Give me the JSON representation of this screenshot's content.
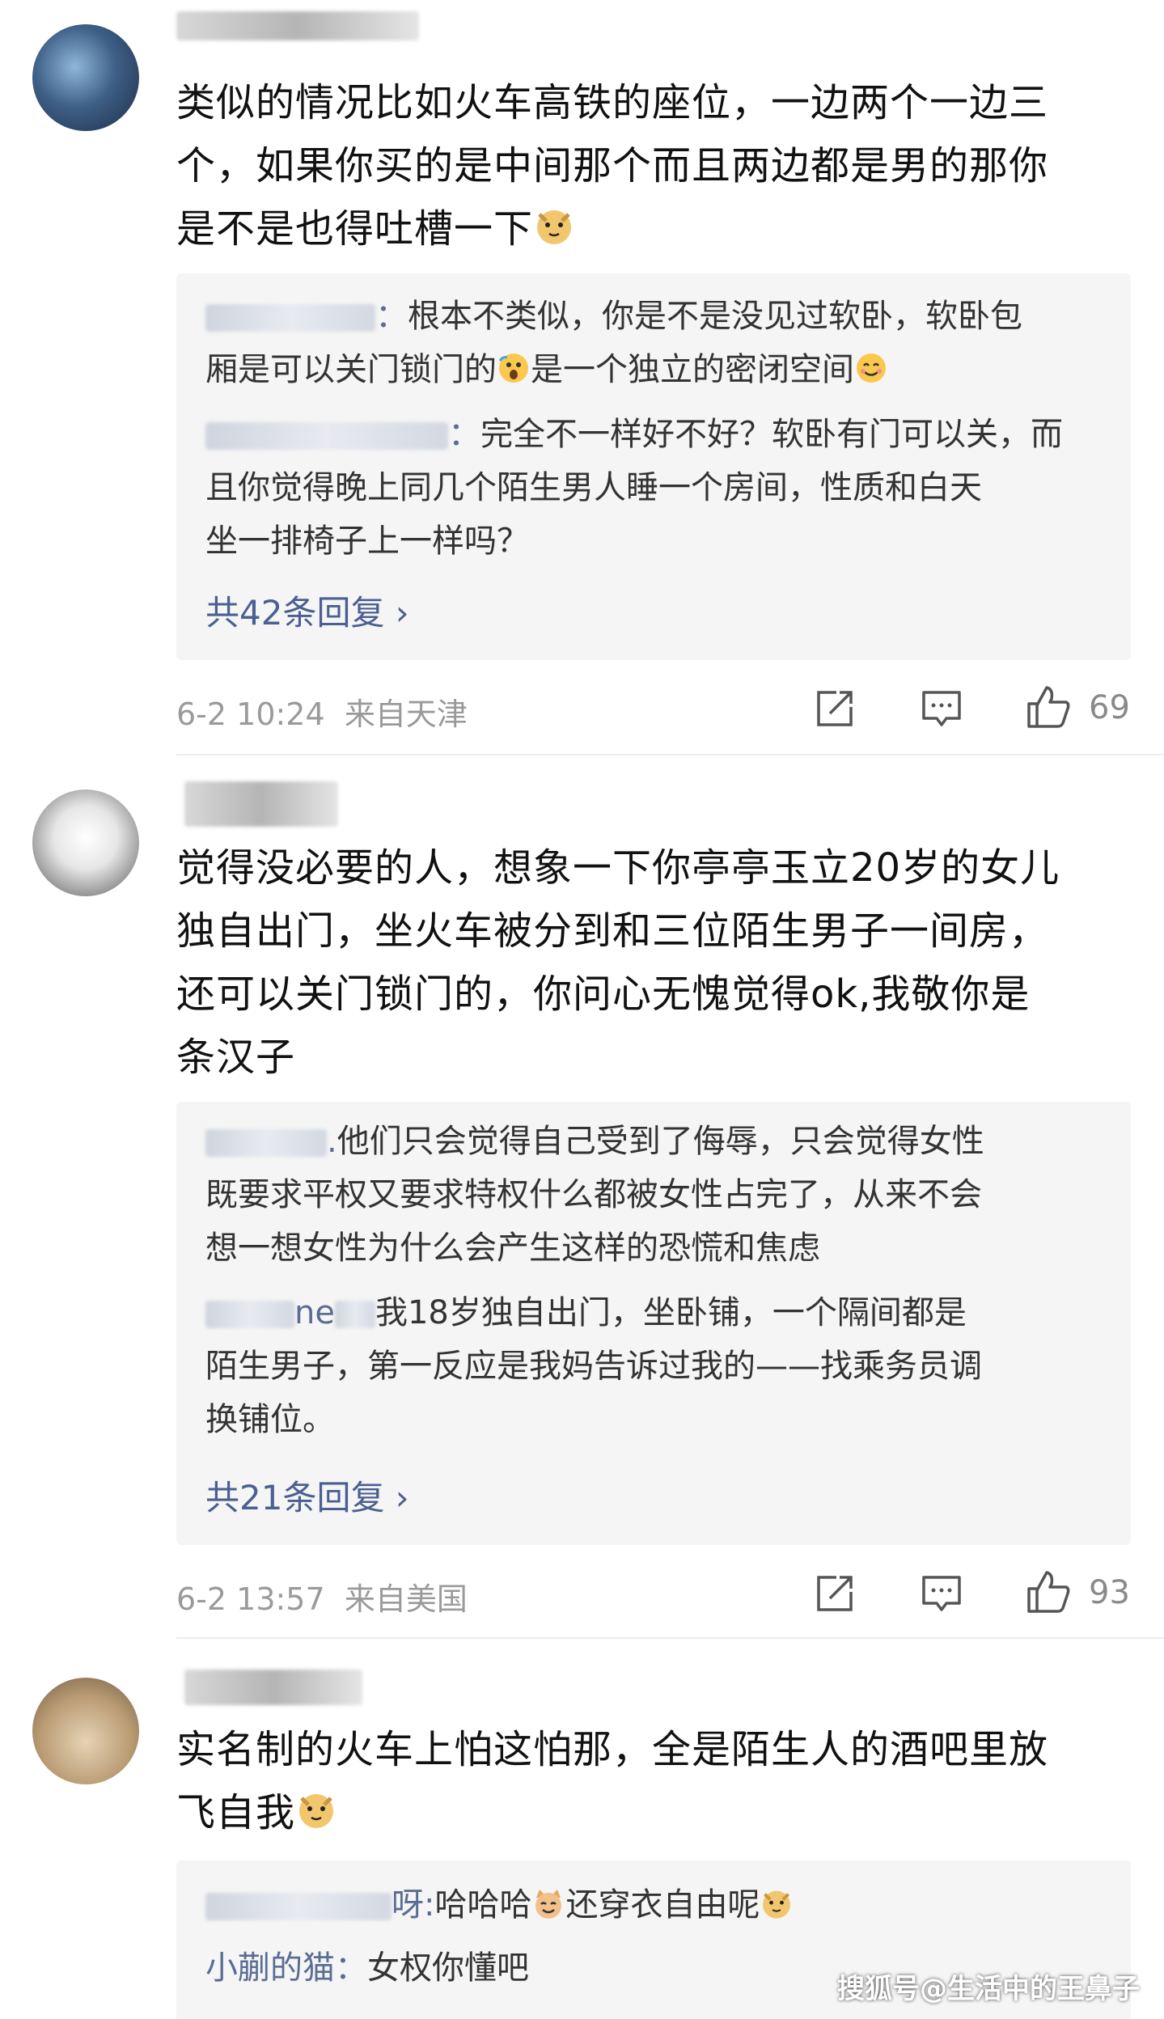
{
  "comments": [
    {
      "text_lines": [
        "类似的情况比如火车高铁的座位，一边两个一边三",
        "个，如果你买的是中间那个而且两边都是男的那你",
        "是不是也得吐槽一下"
      ],
      "replies": [
        {
          "lines": [
            "根本不类似，你是不是没见过软卧，软卧包",
            "厢是可以关门锁门的",
            "是一个独立的密闭空间"
          ]
        },
        {
          "lines": [
            "完全不一样好不好？软卧有门可以关，而",
            "且你觉得晚上同几个陌生男人睡一个房间，性质和白天",
            "坐一排椅子上一样吗？"
          ]
        }
      ],
      "more_label": "共42条回复 ›",
      "timestamp": "6-2 10:24",
      "location": "来自天津",
      "likes": "69"
    },
    {
      "text_lines": [
        "觉得没必要的人，想象一下你亭亭玉立20岁的女儿",
        "独自出门，坐火车被分到和三位陌生男子一间房，",
        "还可以关门锁门的，你问心无愧觉得ok,我敬你是",
        "条汉子"
      ],
      "replies": [
        {
          "lines": [
            "他们只会觉得自己受到了侮辱，只会觉得女性",
            "既要求平权又要求特权什么都被女性占完了，从来不会",
            "想一想女性为什么会产生这样的恐慌和焦虑"
          ]
        },
        {
          "name_suffix": "ne",
          "lines": [
            "我18岁独自出门，坐卧铺，一个隔间都是",
            "陌生男子，第一反应是我妈告诉过我的——找乘务员调",
            "换铺位。"
          ]
        }
      ],
      "more_label": "共21条回复 ›",
      "timestamp": "6-2 13:57",
      "location": "来自美国",
      "likes": "93"
    },
    {
      "text_lines": [
        "实名制的火车上怕这怕那，全是陌生人的酒吧里放",
        "飞自我"
      ],
      "replies": [
        {
          "name_suffix": "呀:",
          "lines": [
            "哈哈哈",
            "还穿衣自由呢"
          ]
        },
        {
          "name": "小蒯的猫",
          "lines": [
            "女权你懂吧"
          ]
        }
      ]
    }
  ],
  "icons": {
    "share": "share-icon",
    "reply": "comment-icon",
    "like": "thumbs-up-icon",
    "emoji": "doge-emoji"
  },
  "watermark": "搜狐号@生活中的王鼻子",
  "colors": {
    "reply_name": "#5b6d94",
    "more_link": "#4a5f92",
    "meta": "#9a9a9a"
  }
}
